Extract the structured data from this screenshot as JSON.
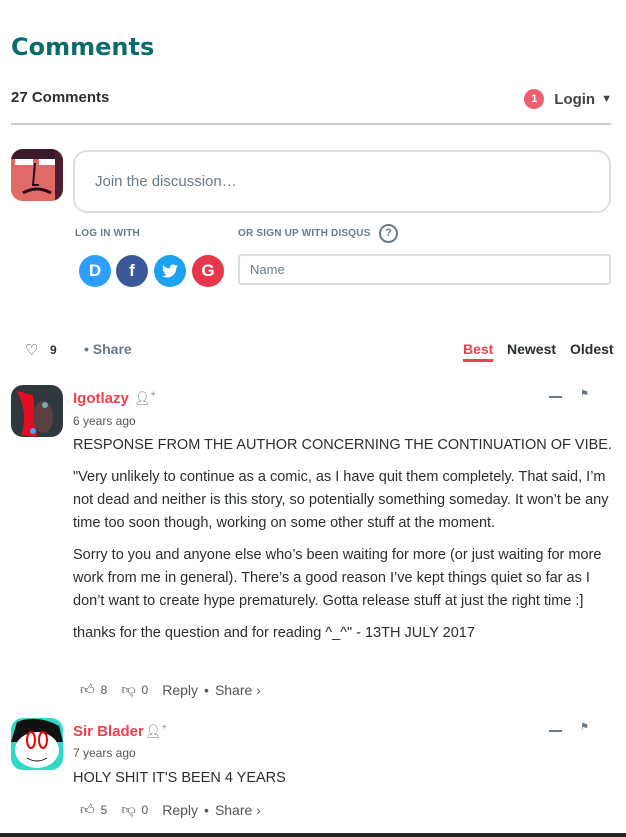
{
  "header": {
    "title": "Comments",
    "count": "27 Comments",
    "notifications": "1",
    "login": "Login"
  },
  "composer": {
    "placeholder": "Join the discussion…",
    "login_with": "LOG IN WITH",
    "signup": "OR SIGN UP WITH DISQUS",
    "help": "?",
    "name_placeholder": "Name",
    "social": [
      "D",
      "f",
      "t",
      "G"
    ]
  },
  "toolbar": {
    "likes": "9",
    "share": "Share",
    "sort": [
      "Best",
      "Newest",
      "Oldest"
    ],
    "active_sort": "Best"
  },
  "comments": [
    {
      "author": "Igotlazy",
      "time": "6 years ago",
      "paragraphs": [
        "RESPONSE FROM THE AUTHOR CONCERNING THE CONTINUATION OF VIBE.",
        "\"Very unlikely to continue as a comic, as I have quit them completely. That said, I’m not dead and neither is this story, so potentially something someday. It won’t be any time too soon though, working on some other stuff at the moment.",
        "Sorry to you and anyone else who’s been waiting for more (or just waiting for more work from me in general). There’s a good reason I’ve kept things quiet so far as I don’t want to create hype prematurely. Gotta release stuff at just the right time :]",
        "thanks for the question and for reading ^_^\" - 13TH JULY 2017"
      ],
      "upvotes": "8",
      "downvotes": "0",
      "reply": "Reply",
      "share": "Share ›"
    },
    {
      "author": "Sir Blader",
      "time": "7 years ago",
      "paragraphs": [
        "HOLY SHIT IT'S BEEN 4 YEARS"
      ],
      "upvotes": "5",
      "downvotes": "0",
      "reply": "Reply",
      "share": "Share ›"
    }
  ],
  "colors": {
    "title": "#0e6b6b",
    "accent": "#f04050",
    "disqus": "#2e9fff",
    "facebook": "#3b5998",
    "twitter": "#1da1f2",
    "google": "#dd4b39"
  }
}
